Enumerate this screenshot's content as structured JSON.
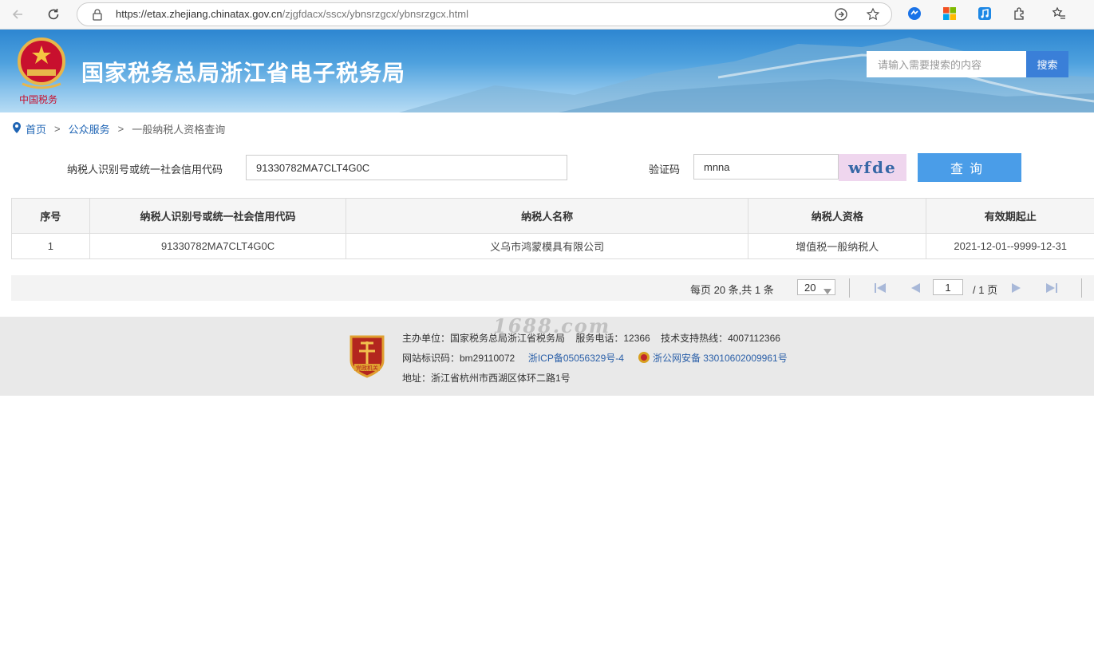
{
  "browser": {
    "url_host": "https://etax.zhejiang.chinatax.gov.cn",
    "url_path": "/zjgfdacx/sscx/ybnsrzgcx/ybnsrzgcx.html"
  },
  "header": {
    "title": "国家税务总局浙江省电子税务局",
    "search_placeholder": "请输入需要搜索的内容",
    "search_button": "搜索"
  },
  "breadcrumb": {
    "home": "首页",
    "sep": ">",
    "public_service": "公众服务",
    "current": "一般纳税人资格查询"
  },
  "form": {
    "taxpayer_id_label": "纳税人识别号或统一社会信用代码",
    "taxpayer_id_value": "91330782MA7CLT4G0C",
    "captcha_label": "验证码",
    "captcha_value": "mnna",
    "captcha_image_text": "wfde",
    "query_button": "查询"
  },
  "table": {
    "headers": [
      "序号",
      "纳税人识别号或统一社会信用代码",
      "纳税人名称",
      "纳税人资格",
      "有效期起止"
    ],
    "rows": [
      [
        "1",
        "91330782MA7CLT4G0C",
        "义乌市鸿蒙模具有限公司",
        "增值税一般纳税人",
        "2021-12-01--9999-12-31"
      ]
    ]
  },
  "pager": {
    "info": "每页 20 条,共 1 条",
    "page_size": "20",
    "current_page": "1",
    "total_pages": "/ 1 页"
  },
  "footer": {
    "sponsor": "主办单位：国家税务总局浙江省税务局",
    "service_phone": "服务电话：12366",
    "support_hotline": "技术支持热线：4007112366",
    "site_id": "网站标识码：bm29110072",
    "icp": "浙ICP备05056329号-4",
    "police": "浙公网安备 33010602009961号",
    "address": "地址：浙江省杭州市西湖区体环二路1号",
    "watermark": "1688.com",
    "badge_text": "党政机关"
  },
  "colors": {
    "banner": "#3d95dc",
    "link": "#1e64b4",
    "button": "#4a9de8",
    "search_button": "#3a7fd8"
  }
}
